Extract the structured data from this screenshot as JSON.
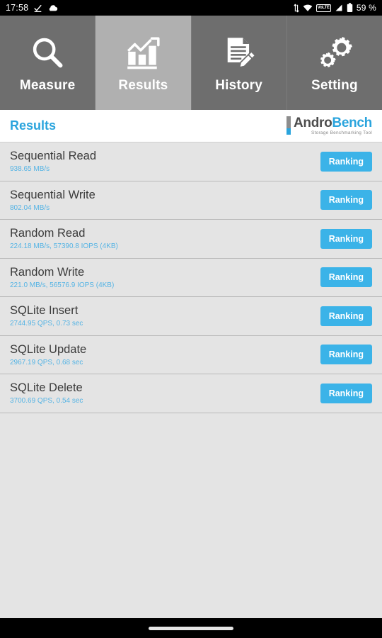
{
  "statusbar": {
    "time": "17:58",
    "left_icons": [
      "download-check-icon",
      "cloud-icon"
    ],
    "right_icons": [
      "data-transfer-icon",
      "wifi-icon",
      "volte-icon",
      "signal-icon",
      "battery-icon"
    ],
    "volte_label": "VoLTE",
    "battery_percent": "59 %"
  },
  "tabs": [
    {
      "label": "Measure",
      "icon": "magnifier-icon",
      "active": false
    },
    {
      "label": "Results",
      "icon": "bar-chart-icon",
      "active": true
    },
    {
      "label": "History",
      "icon": "document-pencil-icon",
      "active": false
    },
    {
      "label": "Setting",
      "icon": "gears-icon",
      "active": false
    }
  ],
  "header": {
    "title": "Results",
    "logo": {
      "part1": "Andro",
      "part2": "Bench",
      "tagline": "Storage Benchmarking Tool"
    }
  },
  "results": [
    {
      "title": "Sequential Read",
      "value": "938.65 MB/s",
      "button": "Ranking"
    },
    {
      "title": "Sequential Write",
      "value": "802.04 MB/s",
      "button": "Ranking"
    },
    {
      "title": "Random Read",
      "value": "224.18 MB/s, 57390.8 IOPS (4KB)",
      "button": "Ranking"
    },
    {
      "title": "Random Write",
      "value": "221.0 MB/s, 56576.9 IOPS (4KB)",
      "button": "Ranking"
    },
    {
      "title": "SQLite Insert",
      "value": "2744.95 QPS, 0.73 sec",
      "button": "Ranking"
    },
    {
      "title": "SQLite Update",
      "value": "2967.19 QPS, 0.68 sec",
      "button": "Ranking"
    },
    {
      "title": "SQLite Delete",
      "value": "3700.69 QPS, 0.54 sec",
      "button": "Ranking"
    }
  ],
  "colors": {
    "accent_blue": "#3bb3e8",
    "title_blue": "#2aa4dd",
    "value_blue": "#56b4e4",
    "tab_bg": "#6e6e6e",
    "tab_active_bg": "#b0b0b0",
    "list_bg": "#e4e4e4"
  },
  "navbar": {
    "handle": "gesture-pill"
  }
}
